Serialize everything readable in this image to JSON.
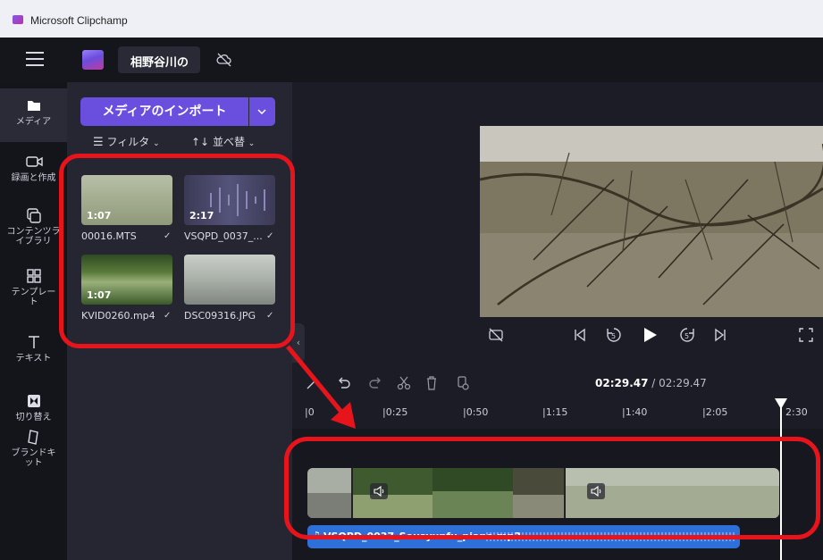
{
  "window": {
    "title": "Microsoft Clipchamp"
  },
  "topbar": {
    "project_name": "相野谷川の"
  },
  "sidebar": {
    "items": [
      {
        "label": "メディア",
        "icon": "folder-icon"
      },
      {
        "label": "録画と作成",
        "icon": "camera-icon"
      },
      {
        "label": "コンテンツライブラリ",
        "icon": "library-icon"
      },
      {
        "label": "テンプレート",
        "icon": "template-icon"
      },
      {
        "label": "テキスト",
        "icon": "text-icon"
      },
      {
        "label": "切り替え",
        "icon": "transition-icon"
      },
      {
        "label": "ブランドキット",
        "icon": "brand-kit-icon"
      }
    ]
  },
  "media": {
    "import_label": "メディアのインポート",
    "filter_label": "フィルタ",
    "sort_label": "並べ替",
    "items": [
      {
        "name": "00016.MTS",
        "duration": "1:07"
      },
      {
        "name": "VSQPD_0037_...",
        "duration": "2:17"
      },
      {
        "name": "KVID0260.mp4",
        "duration": "1:07"
      },
      {
        "name": "DSC09316.JPG",
        "duration": ""
      }
    ]
  },
  "timeline": {
    "current_time": "02:29.47",
    "separator": " / ",
    "total_time": "02:29.47",
    "ticks": [
      "0",
      "0:25",
      "0:50",
      "1:15",
      "1:40",
      "2:05",
      "2:30"
    ],
    "audio_clip_name": "VSQPD_0037_Sousyunfu_piano.mp3"
  },
  "colors": {
    "accent": "#6a4fdf",
    "highlight": "#e8141c",
    "audio": "#2f6fd8"
  }
}
